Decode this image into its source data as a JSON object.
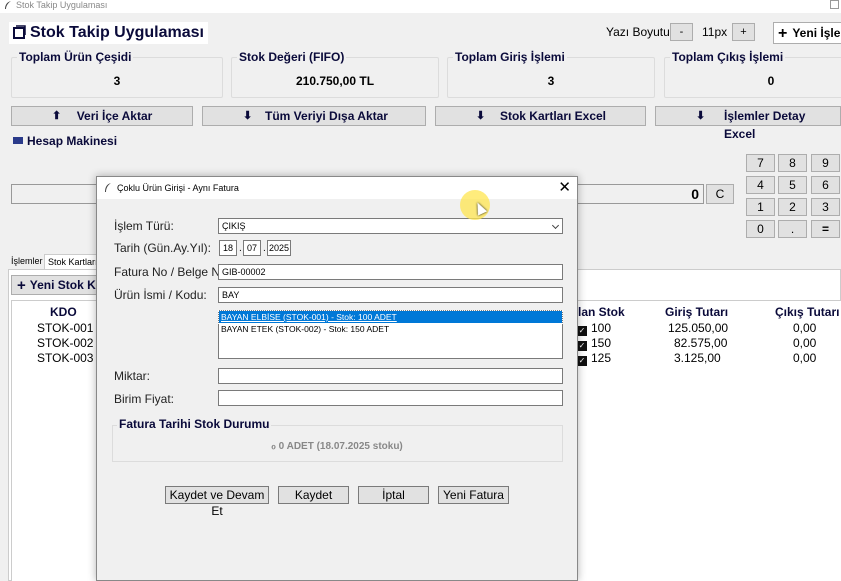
{
  "window": {
    "title": "Stok Takip Uygulaması"
  },
  "app": {
    "title": "Stok Takip Uygulaması"
  },
  "font": {
    "label": "Yazı Boyutu:",
    "minus": "-",
    "value": "11px",
    "plus": "+"
  },
  "header": {
    "new_button": "Yeni İşlem"
  },
  "stats": [
    {
      "label": "Toplam Ürün Çeşidi",
      "value": "3"
    },
    {
      "label": "Stok Değeri (FIFO)",
      "value": "210.750,00 TL"
    },
    {
      "label": "Toplam Giriş İşlemi",
      "value": "3"
    },
    {
      "label": "Toplam Çıkış İşlemi",
      "value": "0"
    }
  ],
  "actions": [
    {
      "label": "Veri İçe Aktar",
      "icon": "arrow-up-icon",
      "glyph": "⬆"
    },
    {
      "label": "Tüm Veriyi Dışa Aktar",
      "icon": "arrow-down-icon",
      "glyph": "⬇"
    },
    {
      "label": "Stok Kartları Excel",
      "icon": "arrow-down-icon",
      "glyph": "⬇"
    },
    {
      "label": "İşlemler Detay Excel",
      "icon": "arrow-down-icon",
      "glyph": "⬇"
    }
  ],
  "calculator": {
    "title": "Hesap Makinesi",
    "display": "0",
    "clear": "C",
    "keys": [
      [
        "7",
        "8",
        "9"
      ],
      [
        "4",
        "5",
        "6"
      ],
      [
        "1",
        "2",
        "3"
      ],
      [
        "0",
        ".",
        "="
      ]
    ]
  },
  "tabs": [
    {
      "label": "İşlemler"
    },
    {
      "label": "Stok Kartları"
    }
  ],
  "stock_panel": {
    "add_button": "Yeni Stok Kartı",
    "columns": [
      "KDO",
      "lan Stok",
      "Giriş Tutarı",
      "Çıkış Tutarı"
    ],
    "rows": [
      {
        "code": "STOK-001",
        "stock": "100",
        "in": "125.050,00",
        "out": "0,00"
      },
      {
        "code": "STOK-002",
        "stock": "150",
        "in": "82.575,00",
        "out": "0,00"
      },
      {
        "code": "STOK-003",
        "stock": "125",
        "in": "3.125,00",
        "out": "0,00"
      }
    ]
  },
  "dialog": {
    "title": "Çoklu Ürün Girişi - Aynı Fatura",
    "close": "✕",
    "fields": {
      "type_label": "İşlem Türü:",
      "type_value": "ÇIKIŞ",
      "date_label": "Tarih (Gün.Ay.Yıl):",
      "day": "18",
      "month": "07",
      "year": "2025",
      "invoice_label": "Fatura No / Belge No:",
      "invoice_value": "GIB-00002",
      "product_label": "Ürün İsmi / Kodu:",
      "product_value": "BAY",
      "qty_label": "Miktar:",
      "qty_value": "",
      "price_label": "Birim Fiyat:",
      "price_value": ""
    },
    "list": [
      "BAYAN ELBİSE (STOK-001) - Stok: 100 ADET",
      "BAYAN ETEK (STOK-002) - Stok: 150 ADET"
    ],
    "group": {
      "label": "Fatura Tarihi Stok Durumu",
      "value": "ℴ 0 ADET (18.07.2025 stoku)"
    },
    "buttons": {
      "save_continue": "Kaydet ve Devam Et",
      "save": "Kaydet",
      "cancel": "İptal",
      "new_invoice": "Yeni Fatura"
    }
  }
}
